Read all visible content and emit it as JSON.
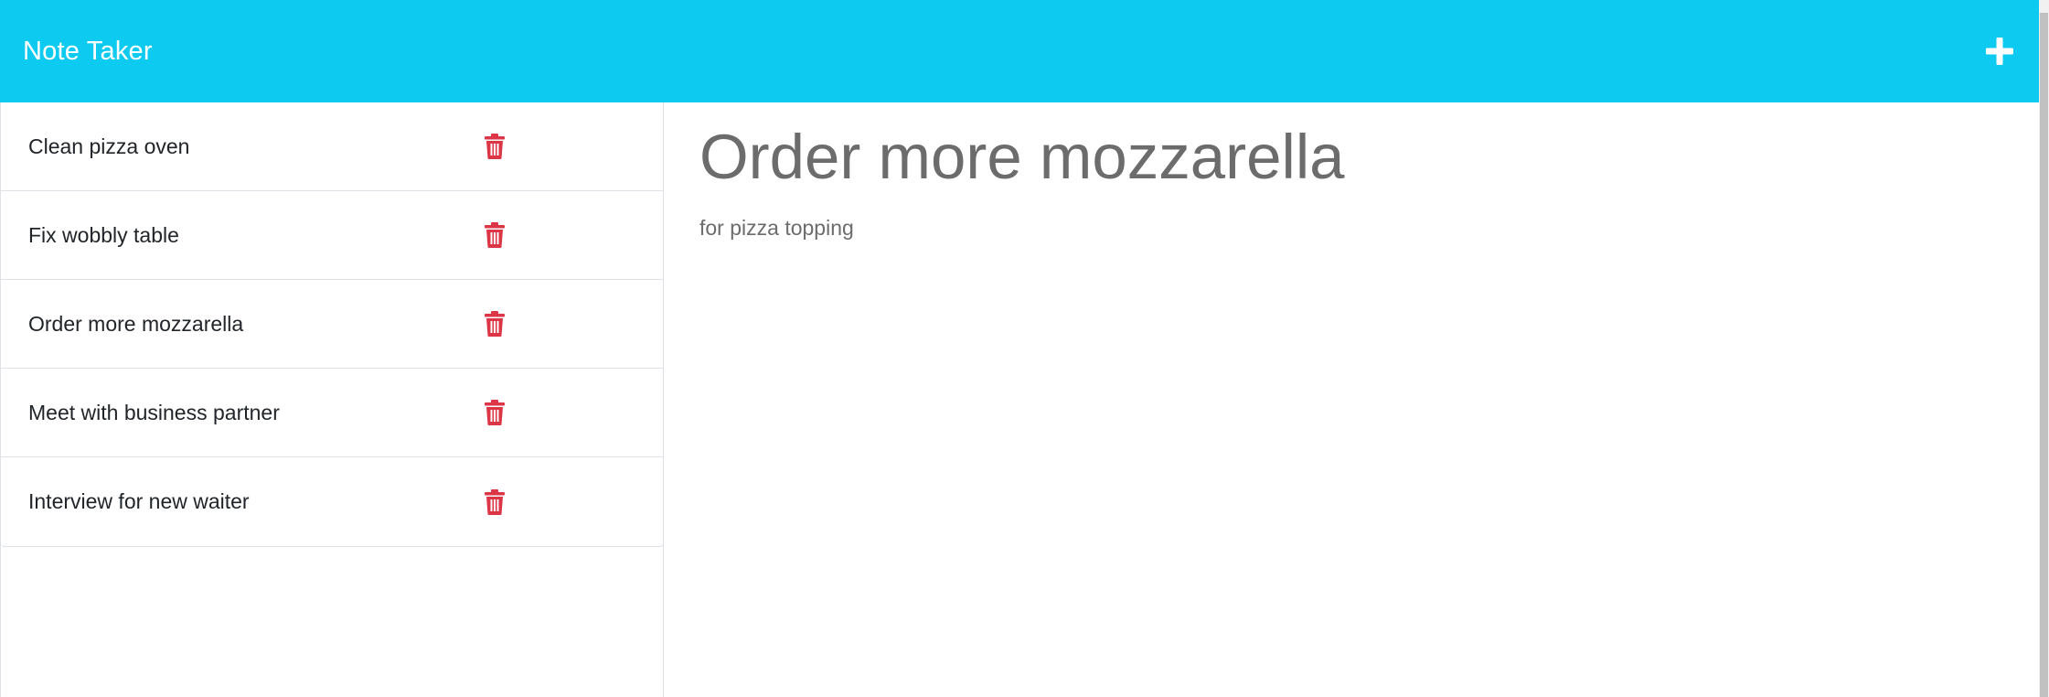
{
  "app": {
    "brand": "Note Taker",
    "new_note_icon": "plus-icon",
    "colors": {
      "navbar": "#0dcaf0",
      "delete": "#dc3545",
      "note_text": "#6c6c6c"
    }
  },
  "notes": [
    {
      "title": "Clean pizza oven",
      "icon": "trash-icon"
    },
    {
      "title": "Fix wobbly table",
      "icon": "trash-icon"
    },
    {
      "title": "Order more mozzarella",
      "icon": "trash-icon"
    },
    {
      "title": "Meet with business partner",
      "icon": "trash-icon"
    },
    {
      "title": "Interview for new waiter",
      "icon": "trash-icon"
    }
  ],
  "active_note": {
    "title": "Order more mozzarella",
    "text": "for pizza topping"
  }
}
